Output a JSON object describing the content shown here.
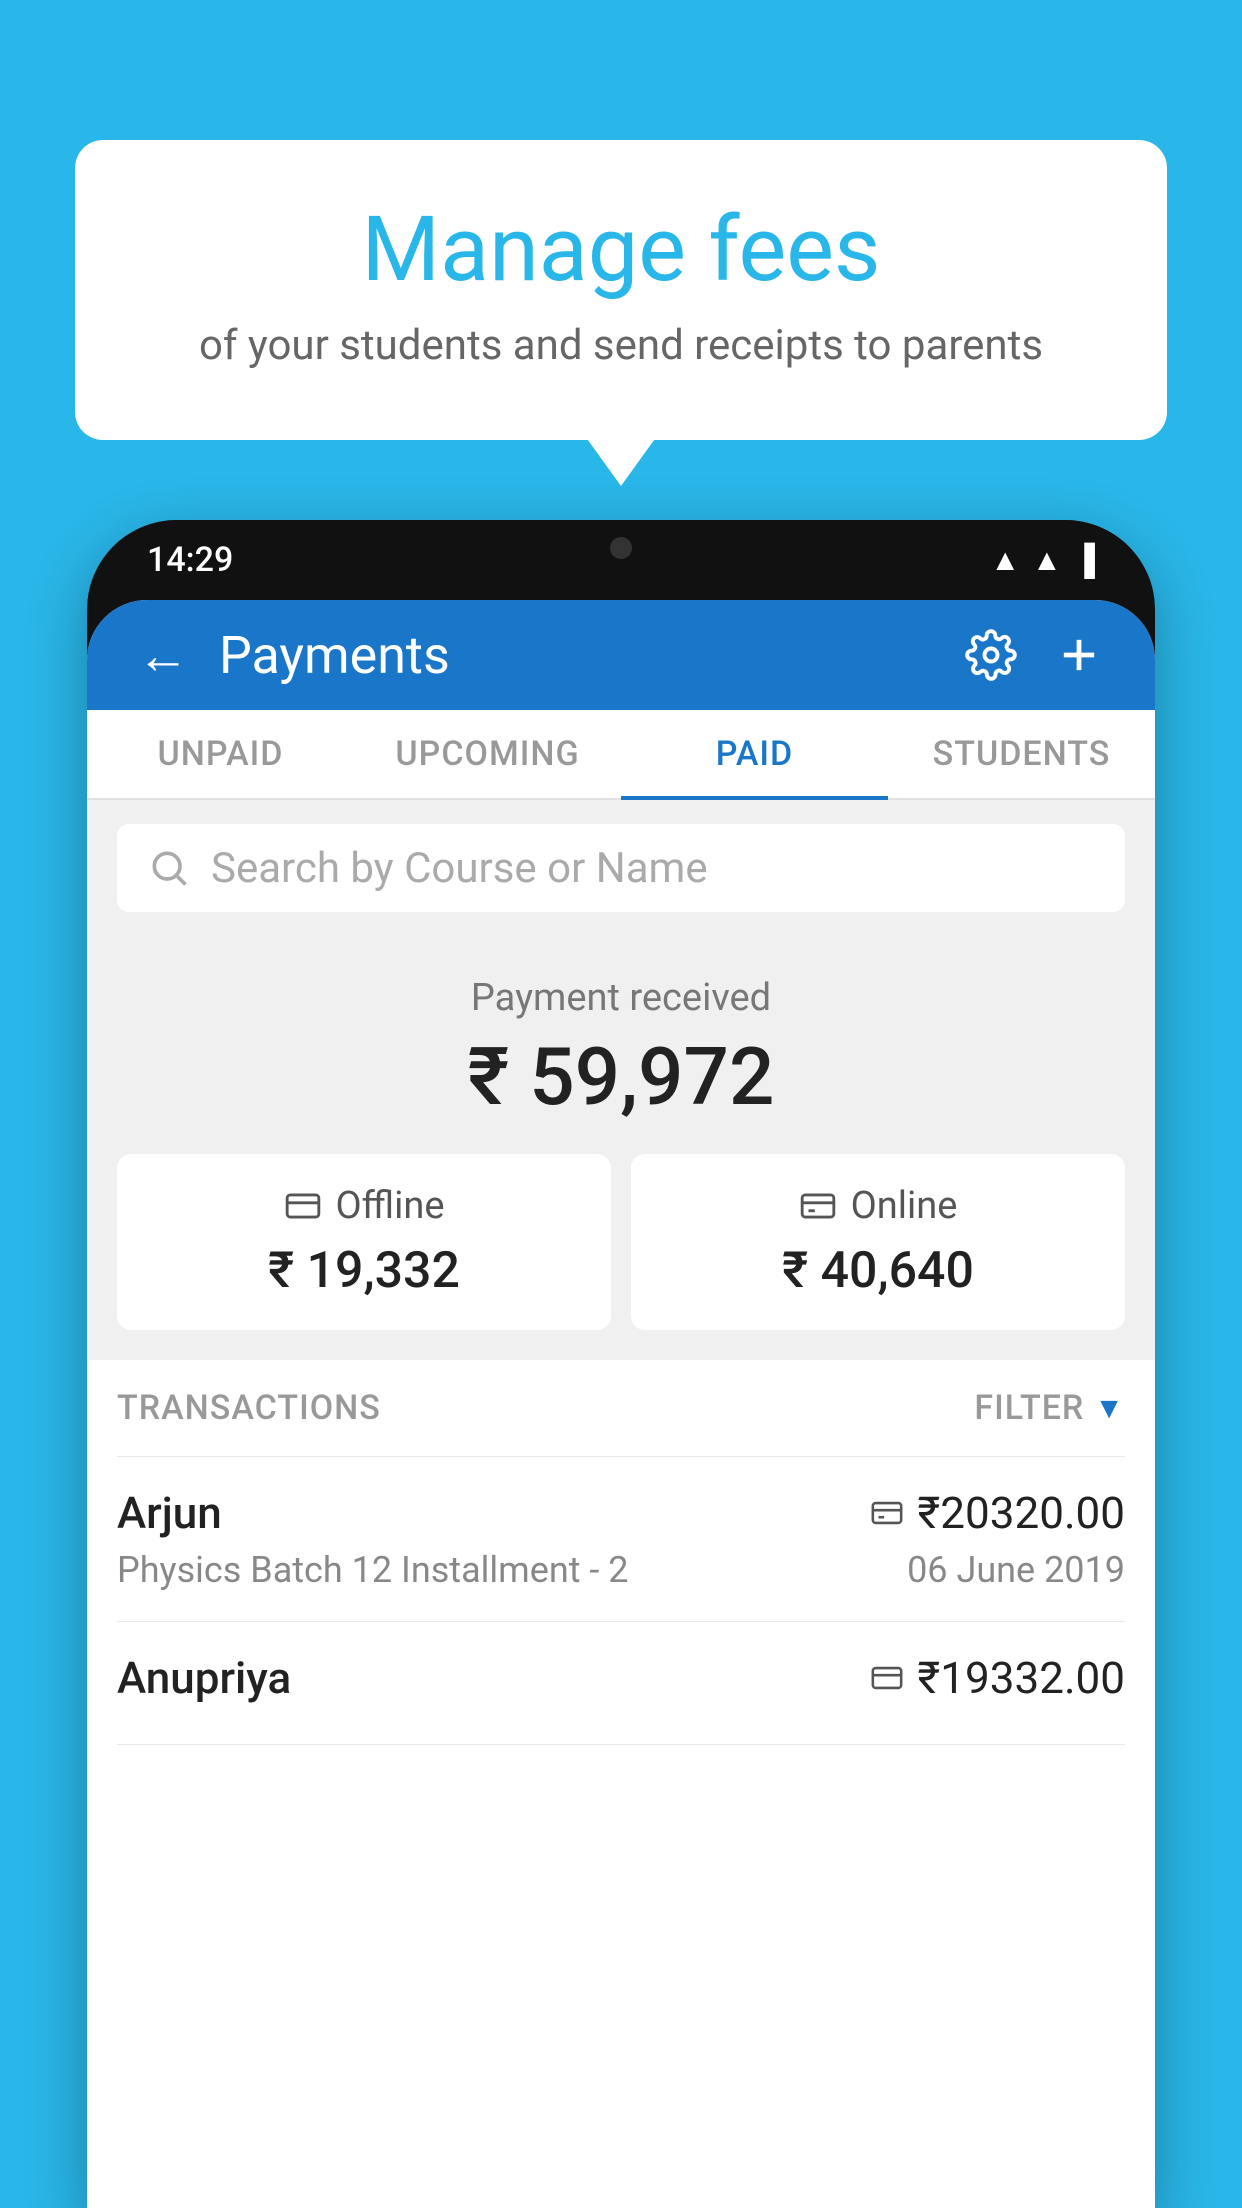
{
  "background_color": "#29b6e8",
  "speech_bubble": {
    "title": "Manage fees",
    "subtitle": "of your students and send receipts to parents"
  },
  "phone": {
    "status_bar": {
      "time": "14:29"
    },
    "header": {
      "back_label": "←",
      "title": "Payments",
      "settings_icon": "gear-icon",
      "add_icon": "plus-icon"
    },
    "tabs": [
      {
        "label": "UNPAID",
        "active": false
      },
      {
        "label": "UPCOMING",
        "active": false
      },
      {
        "label": "PAID",
        "active": true
      },
      {
        "label": "STUDENTS",
        "active": false
      }
    ],
    "search": {
      "placeholder": "Search by Course or Name"
    },
    "payment_received": {
      "label": "Payment received",
      "total": "₹ 59,972",
      "offline": {
        "type": "Offline",
        "amount": "₹ 19,332"
      },
      "online": {
        "type": "Online",
        "amount": "₹ 40,640"
      }
    },
    "transactions": {
      "header_label": "TRANSACTIONS",
      "filter_label": "FILTER",
      "rows": [
        {
          "name": "Arjun",
          "amount": "₹20320.00",
          "payment_type": "online",
          "course": "Physics Batch 12 Installment - 2",
          "date": "06 June 2019"
        },
        {
          "name": "Anupriya",
          "amount": "₹19332.00",
          "payment_type": "offline",
          "course": "",
          "date": ""
        }
      ]
    }
  }
}
